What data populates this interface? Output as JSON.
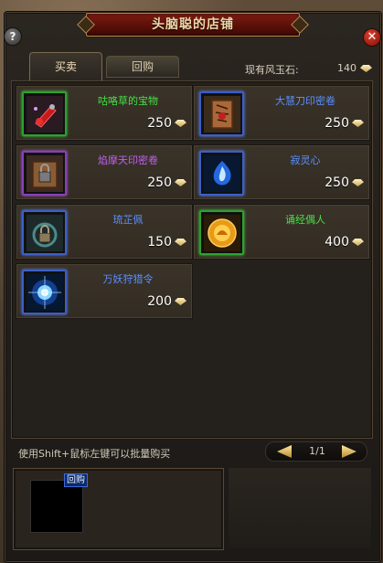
{
  "window": {
    "title": "头脑聪的店铺",
    "help_label": "?",
    "close_label": "✕"
  },
  "tabs": [
    {
      "label": "买卖",
      "active": true
    },
    {
      "label": "回购",
      "active": false
    }
  ],
  "currency": {
    "label": "现有风玉石:",
    "value": "140",
    "icon": "jade-stone-icon"
  },
  "items": [
    {
      "name": "咕咯草的宝物",
      "price": "250",
      "quality": "green",
      "icon": "red-treasure-icon"
    },
    {
      "name": "大慧刀印密卷",
      "price": "250",
      "quality": "blue",
      "icon": "scroll-icon"
    },
    {
      "name": "焰摩天印密卷",
      "price": "250",
      "quality": "purple",
      "icon": "locked-scroll-icon"
    },
    {
      "name": "寂灵心",
      "price": "250",
      "quality": "blue",
      "icon": "spirit-heart-icon"
    },
    {
      "name": "琉芷佩",
      "price": "150",
      "quality": "blue",
      "icon": "pendant-icon"
    },
    {
      "name": "诵经偶人",
      "price": "400",
      "quality": "green",
      "icon": "chanting-doll-icon"
    },
    {
      "name": "万妖狩猎令",
      "price": "200",
      "quality": "blue",
      "icon": "hunting-token-icon"
    }
  ],
  "hint": "使用Shift+鼠标左键可以批量购买",
  "pager": {
    "page": "1/1"
  },
  "buyback": {
    "tag": "回购"
  },
  "colors": {
    "green": "#46e046",
    "blue": "#5a90ff",
    "purple": "#c060f0",
    "title_red": "#6a1208",
    "gold": "#c9a75a"
  }
}
